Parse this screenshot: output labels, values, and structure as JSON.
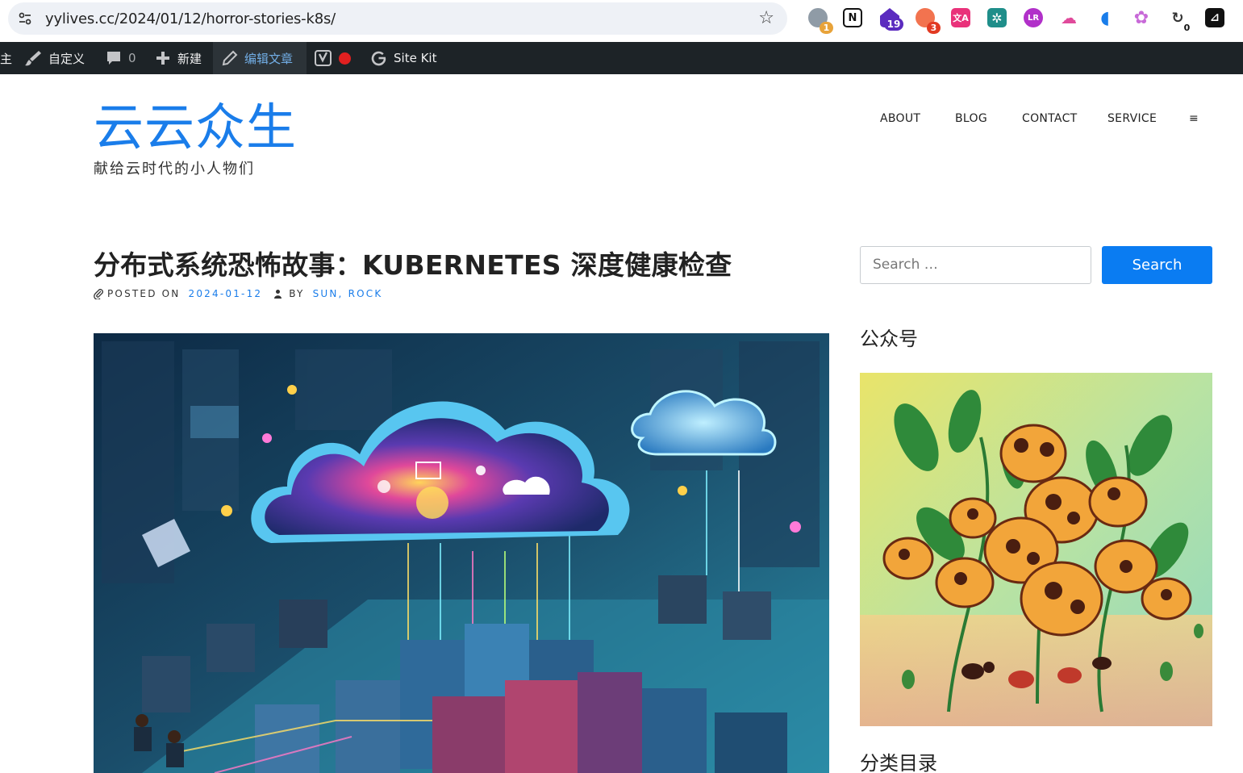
{
  "browser": {
    "url": "yylives.cc/2024/01/12/horror-stories-k8s/",
    "extensions": [
      {
        "name": "extension-1",
        "badge": "1",
        "color": "#7a8a99",
        "badge_color": "#e8a33a"
      },
      {
        "name": "notion",
        "glyph": "N",
        "color": "#ffffff"
      },
      {
        "name": "extension-3",
        "badge": "19",
        "color": "#5b2bbf",
        "badge_color": "#5b2bbf"
      },
      {
        "name": "extension-4",
        "badge": "3",
        "color": "#e34b2b",
        "badge_color": "#e23a22"
      },
      {
        "name": "translate",
        "glyph": "文A",
        "color": "#e9327a"
      },
      {
        "name": "extension-6",
        "glyph": "✲",
        "color": "#1f8e8a"
      },
      {
        "name": "extension-7",
        "glyph": "LR",
        "color": "#b130c9"
      },
      {
        "name": "extension-8",
        "glyph": "☁",
        "color": "#ffffff"
      },
      {
        "name": "extension-9",
        "glyph": "◖",
        "color": "#ffffff"
      },
      {
        "name": "chatgpt",
        "glyph": "✿",
        "color": "#ffffff"
      },
      {
        "name": "extension-11",
        "badge": "0",
        "color": "#ffffff",
        "badge_color": "#ffffff"
      },
      {
        "name": "extension-12",
        "glyph": "⊿",
        "color": "#111111"
      }
    ]
  },
  "adminbar": {
    "site_fragment": "主",
    "customize": "自定义",
    "comments_count": "0",
    "new": "新建",
    "edit_post": "编辑文章",
    "sitekit": "Site Kit"
  },
  "site": {
    "title": "云云众生",
    "description": "献给云时代的小人物们",
    "nav": [
      "ABOUT",
      "BLOG",
      "CONTACT",
      "SERVICE",
      "≡"
    ]
  },
  "post": {
    "title": "分布式系统恐怖故事：KUBERNETES 深度健康检查",
    "meta": {
      "posted_on_label": "POSTED ON",
      "date": "2024-01-12",
      "by_label": "BY",
      "author": "SUN, ROCK"
    }
  },
  "sidebar": {
    "search_placeholder": "Search …",
    "search_button": "Search",
    "widget_wechat": "公众号",
    "widget_categories": "分类目录"
  },
  "colors": {
    "accent": "#1a7dea",
    "adminbar_bg": "#1d2327",
    "search_button": "#0a7cf2"
  }
}
